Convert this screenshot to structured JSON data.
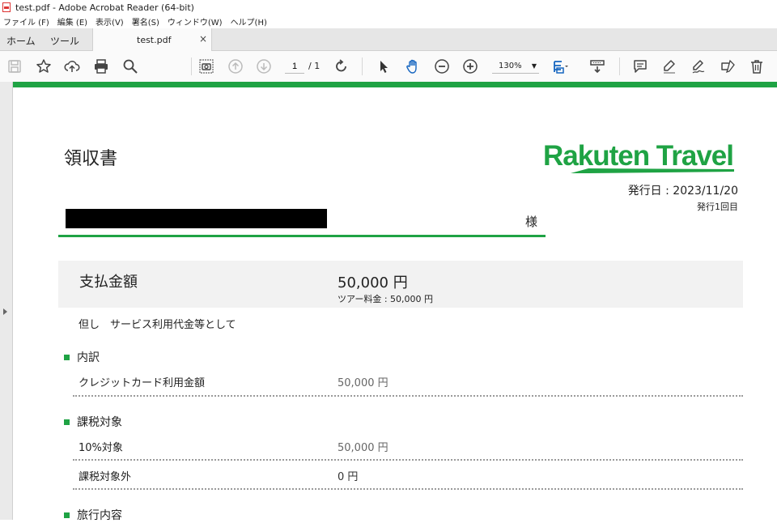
{
  "window": {
    "title": "test.pdf - Adobe Acrobat Reader (64-bit)"
  },
  "menu": [
    "ファイル (F)",
    "編集 (E)",
    "表示(V)",
    "署名(S)",
    "ウィンドウ(W)",
    "ヘルプ(H)"
  ],
  "tabs": {
    "home": "ホーム",
    "tools": "ツール",
    "doc": "test.pdf",
    "close": "×"
  },
  "toolbar": {
    "page_current": "1",
    "page_total": "/  1",
    "zoom": "130%"
  },
  "colors": {
    "brand_green": "#1fa344"
  },
  "icons": [
    "save-icon",
    "star-icon",
    "cloud-upload-icon",
    "print-icon",
    "search-icon",
    "snapshot-icon",
    "page-up-icon",
    "page-down-icon",
    "rotate-icon",
    "select-arrow-icon",
    "hand-icon",
    "zoom-out-icon",
    "zoom-in-icon",
    "fit-page-icon",
    "scroll-mode-icon",
    "comment-icon",
    "highlight-icon",
    "sign-icon",
    "fill-sign-icon",
    "delete-icon"
  ],
  "receipt": {
    "title": "領収書",
    "logo_text": "Rakuten Travel",
    "issue_date": "発行日 : 2023/11/20",
    "issue_count": "発行1回目",
    "honorific": "様",
    "amount_label": "支払金額",
    "amount_value": "50,000 円",
    "amount_sub": "ツアー料金 : 50,000 円",
    "proviso": "但し　サービス利用代金等として",
    "sections": {
      "breakdown": {
        "heading": "内訳",
        "rows": [
          {
            "label": "クレジットカード利用金額",
            "value": "50,000 円"
          }
        ]
      },
      "taxable": {
        "heading": "課税対象",
        "rows": [
          {
            "label": "10%対象",
            "value": "50,000 円"
          },
          {
            "label": "課税対象外",
            "value": "0 円"
          }
        ]
      },
      "travel": {
        "heading": "旅行内容"
      }
    }
  }
}
